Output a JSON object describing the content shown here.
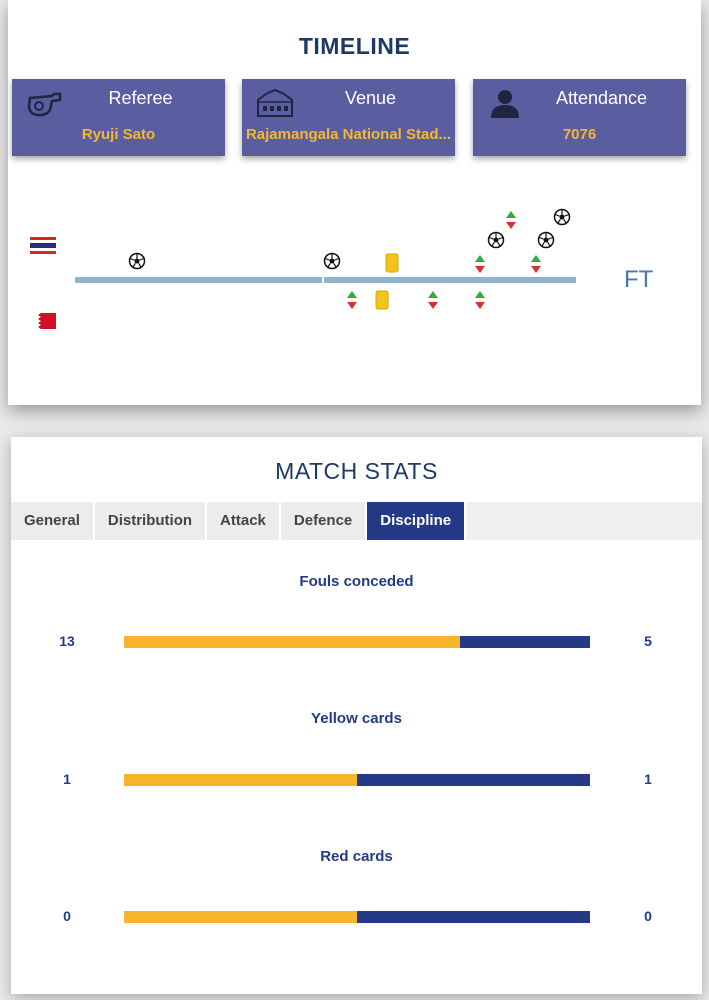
{
  "timeline": {
    "title": "TIMELINE",
    "info": {
      "referee": {
        "label": "Referee",
        "value": "Ryuji Sato",
        "icon": "whistle-icon"
      },
      "venue": {
        "label": "Venue",
        "value": "Rajamangala National Stad...",
        "icon": "stadium-icon"
      },
      "attendance": {
        "label": "Attendance",
        "value": "7076",
        "icon": "crowd-icon"
      }
    },
    "status": "FT",
    "home_flag": "thailand-flag",
    "away_flag": "bahrain-flag",
    "colors": {
      "line": "#8fb4cc",
      "yellow_card": "#f2c318",
      "sub_in": "#3aa83a",
      "sub_out": "#d93030"
    }
  },
  "stats": {
    "title": "MATCH STATS",
    "tabs": [
      "General",
      "Distribution",
      "Attack",
      "Defence",
      "Discipline"
    ],
    "active_tab": "Discipline",
    "items": [
      {
        "label": "Fouls conceded",
        "home": "13",
        "away": "5",
        "home_share": 0.722
      },
      {
        "label": "Yellow cards",
        "home": "1",
        "away": "1",
        "home_share": 0.5
      },
      {
        "label": "Red cards",
        "home": "0",
        "away": "0",
        "home_share": 0.5
      }
    ],
    "colors": {
      "home": "#f7b52c",
      "away": "#253a86"
    }
  }
}
